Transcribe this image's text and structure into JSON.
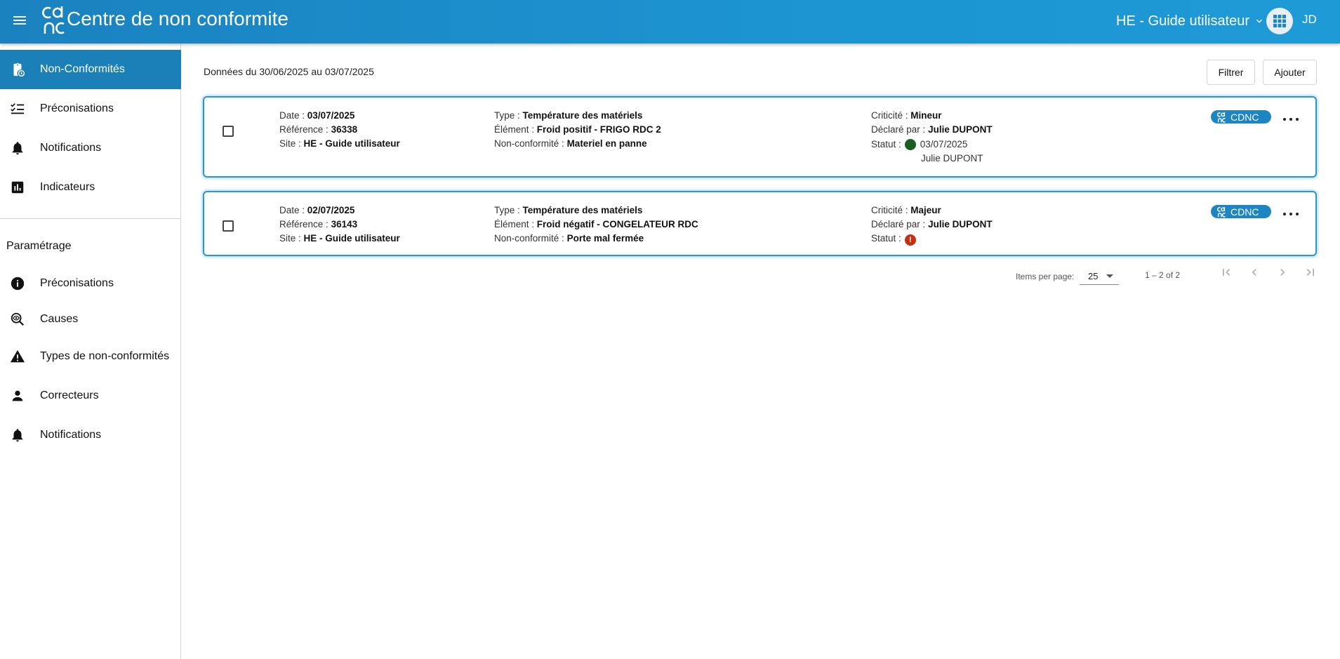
{
  "header": {
    "app_title": "Centre de non conformite",
    "site_selector": "HE - Guide utilisateur",
    "user_initials": "JD"
  },
  "sidebar": {
    "items": [
      {
        "label": "Non-Conformités",
        "icon": "clipboard-clock-icon",
        "active": true
      },
      {
        "label": "Préconisations",
        "icon": "checklist-icon"
      },
      {
        "label": "Notifications",
        "icon": "bell-icon"
      },
      {
        "label": "Indicateurs",
        "icon": "bar-chart-icon"
      }
    ],
    "settings_title": "Paramétrage",
    "settings_items": [
      {
        "label": "Préconisations",
        "icon": "info-icon"
      },
      {
        "label": "Causes",
        "icon": "search-eye-icon"
      },
      {
        "label": "Types de non-conformités",
        "icon": "warning-icon"
      },
      {
        "label": "Correcteurs",
        "icon": "person-icon"
      },
      {
        "label": "Notifications",
        "icon": "bell-icon"
      }
    ]
  },
  "main": {
    "date_range": "Données du 30/06/2025 au 03/07/2025",
    "filter_label": "Filtrer",
    "add_label": "Ajouter",
    "labels": {
      "date": "Date : ",
      "reference": "Référence : ",
      "site": "Site : ",
      "type": "Type : ",
      "element": "Élément : ",
      "non_conformity": "Non-conformité : ",
      "criticity": "Criticité : ",
      "declared_by": "Déclaré par : ",
      "status": "Statut : "
    },
    "cards": [
      {
        "date": "03/07/2025",
        "reference": "36338",
        "site": "HE - Guide utilisateur",
        "type": "Température des matériels",
        "element": "Froid positif - FRIGO RDC 2",
        "non_conformity": "Materiel en panne",
        "criticity": "Mineur",
        "declared_by": "Julie DUPONT",
        "status_date": "03/07/2025",
        "status_by": "Julie DUPONT",
        "status_color": "#1b5e20",
        "badge": "CDNC"
      },
      {
        "date": "02/07/2025",
        "reference": "36143",
        "site": "HE - Guide utilisateur",
        "type": "Température des matériels",
        "element": "Froid négatif - CONGELATEUR RDC",
        "non_conformity": "Porte mal fermée",
        "criticity": "Majeur",
        "declared_by": "Julie DUPONT",
        "status_alert": "!",
        "status_color": "#c62f10",
        "badge": "CDNC"
      }
    ],
    "paginator": {
      "items_per_page_label": "Items per page:",
      "page_size": "25",
      "range_label": "1 – 2 of 2"
    }
  },
  "colors": {
    "header_blue": "#1c8fcc",
    "active_nav": "#1b7fb8",
    "card_border": "#2b97d0"
  }
}
